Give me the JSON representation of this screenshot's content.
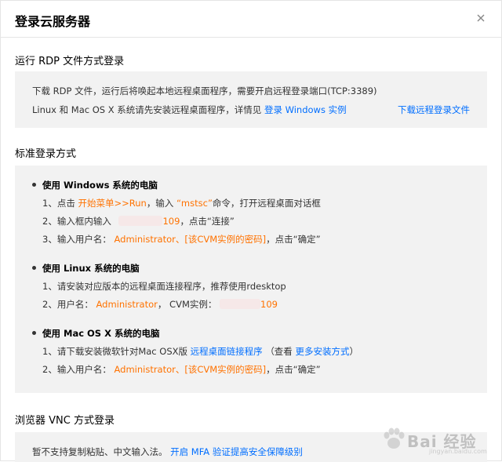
{
  "dialog": {
    "title": "登录云服务器"
  },
  "rdp": {
    "heading": "运行 RDP 文件方式登录",
    "desc1": "下载 RDP 文件，运行后将唤起本地远程桌面程序，需要开启远程登录端口(TCP:3389)",
    "desc2_prefix": "Linux 和 Mac OS X 系统请先安装远程桌面程序，详情见",
    "desc2_link": "登录 Windows 实例",
    "download_link": "下载远程登录文件"
  },
  "standard": {
    "heading": "标准登录方式",
    "windows": {
      "title": "使用 Windows 系统的电脑",
      "s1_prefix": "1、点击",
      "s1_orange1": "开始菜单>>Run",
      "s1_mid": "，输入",
      "s1_orange2": "“mstsc”",
      "s1_suffix": "命令，打开远程桌面对话框",
      "s2_prefix": "2、输入框内输入",
      "s2_ip_suffix": "109",
      "s2_suffix": "，点击“连接”",
      "s3_prefix": "3、输入用户名：",
      "s3_orange": "Administrator、[该CVM实例的密码]",
      "s3_suffix": "，点击“确定”"
    },
    "linux": {
      "title": "使用 Linux 系统的电脑",
      "s1": "1、请安装对应版本的远程桌面连接程序，推荐使用rdesktop",
      "s2_prefix": "2、用户名：",
      "s2_user": "Administrator",
      "s2_mid": "，  CVM实例：",
      "s2_ip_suffix": "109"
    },
    "mac": {
      "title": "使用 Mac OS X 系统的电脑",
      "s1_prefix": "1、请下载安装微软针对Mac OSX版",
      "s1_link1": "远程桌面链接程序",
      "s1_mid": "（查看",
      "s1_link2": "更多安装方式",
      "s1_suffix": "）",
      "s2_prefix": "2、输入用户名：",
      "s2_orange": "Administrator、[该CVM实例的密码]",
      "s2_suffix": "，点击“确定”"
    }
  },
  "vnc": {
    "heading": "浏览器 VNC 方式登录",
    "desc_prefix": "暂不支持复制粘贴、中文输入法。",
    "desc_link": "开启 MFA 验证提高安全保障级别"
  },
  "watermark": {
    "text": "Bai 经验",
    "sub": "jingyan.baidu.com"
  },
  "colors": {
    "link": "#006eff",
    "highlight": "#ff7200",
    "panel_bg": "#f2f2f2"
  },
  "icons": {
    "close": "close-icon"
  }
}
